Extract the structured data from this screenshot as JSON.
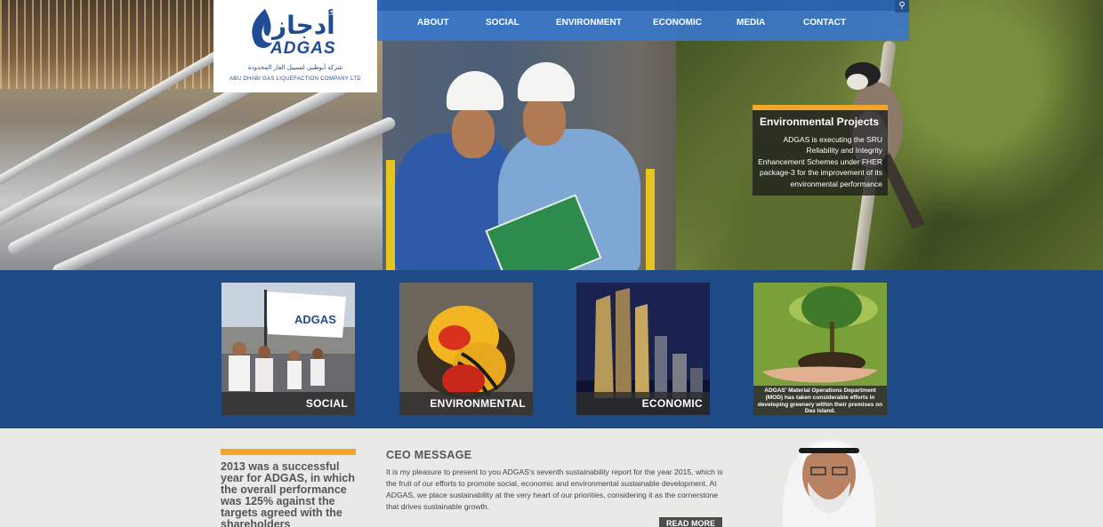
{
  "brand": {
    "logo_arabic": "أدجاز",
    "logo_text": "ADGAS",
    "logo_sub_arabic": "شركة أبوظبي لتسييل الغاز المحدودة",
    "logo_sub_english": "ABU DHABI GAS LIQUEFACTION COMPANY LTD",
    "color_primary": "#1e4d94",
    "color_accent": "#f4a62a"
  },
  "nav": {
    "items": [
      {
        "label": "ABOUT"
      },
      {
        "label": "SOCIAL"
      },
      {
        "label": "ENVIRONMENT"
      },
      {
        "label": "ECONOMIC"
      },
      {
        "label": "MEDIA"
      },
      {
        "label": "CONTACT"
      }
    ],
    "search_icon": "search-icon"
  },
  "feature": {
    "title": "Environmental Projects",
    "text": "ADGAS is executing the SRU Reliability and Integrity Enhancement Schemes under FHER package-3 for the improvement of its environmental performance"
  },
  "tiles": [
    {
      "caption": "SOCIAL"
    },
    {
      "caption": "ENVIRONMENTAL"
    },
    {
      "caption": "ECONOMIC"
    },
    {
      "caption": "ADGAS' Material Operations Department (MOD) has taken considerable efforts in developing greenery within their premises on Das Island."
    }
  ],
  "quote": {
    "text": "2013 was a successful year for ADGAS, in which the overall performance was 125% against the targets agreed with the shareholders"
  },
  "ceo": {
    "title": "CEO MESSAGE",
    "text": "It is my pleasure to present to you ADGAS's seventh sustainability report for the year 2015, which is the fruit of our efforts to promote social, economic and environmental sustainable development. At ADGAS, we place sustainability at the very heart of our priorities, considering it as the cornerstone that drives sustainable growth.",
    "read_more": "READ MORE"
  }
}
